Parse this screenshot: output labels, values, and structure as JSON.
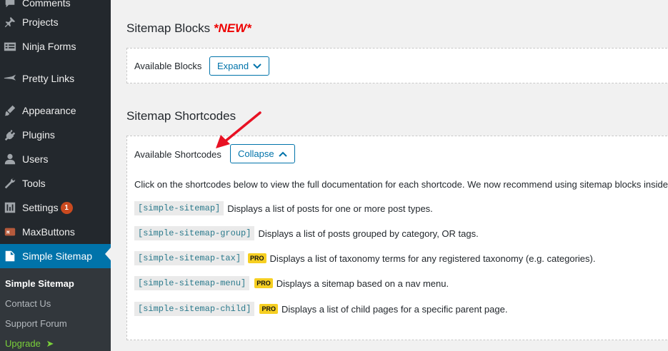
{
  "sidebar": {
    "items": [
      {
        "label": "Comments",
        "icon": "comments-icon"
      },
      {
        "label": "Projects",
        "icon": "pin-icon"
      },
      {
        "label": "Ninja Forms",
        "icon": "forms-icon"
      },
      {
        "label": "Pretty Links",
        "icon": "pretty-links-icon"
      },
      {
        "label": "Appearance",
        "icon": "brush-icon"
      },
      {
        "label": "Plugins",
        "icon": "plug-icon"
      },
      {
        "label": "Users",
        "icon": "user-icon"
      },
      {
        "label": "Tools",
        "icon": "wrench-icon"
      },
      {
        "label": "Settings",
        "icon": "settings-icon",
        "badge": "1"
      },
      {
        "label": "MaxButtons",
        "icon": "maxbuttons-icon"
      },
      {
        "label": "Simple Sitemap",
        "icon": "sitemap-icon"
      }
    ],
    "submenu": [
      "Simple Sitemap",
      "Contact Us",
      "Support Forum",
      "Upgrade"
    ],
    "upgrade_arrow": "➤"
  },
  "blocks": {
    "title": "Sitemap Blocks",
    "new_flag": "*NEW*",
    "label": "Available Blocks",
    "button": "Expand"
  },
  "shortcodes": {
    "title": "Sitemap Shortcodes",
    "label": "Available Shortcodes",
    "button": "Collapse",
    "intro": "Click on the shortcodes below to view the full documentation for each shortcode. We now recommend using sitemap blocks inside",
    "items": [
      {
        "code": "[simple-sitemap]",
        "pro": false,
        "text": "Displays a list of posts for one or more post types."
      },
      {
        "code": "[simple-sitemap-group]",
        "pro": false,
        "text": "Displays a list of posts grouped by category, OR tags."
      },
      {
        "code": "[simple-sitemap-tax]",
        "pro": true,
        "text": "Displays a list of taxonomy terms for any registered taxonomy (e.g. categories)."
      },
      {
        "code": "[simple-sitemap-menu]",
        "pro": true,
        "text": "Displays a sitemap based on a nav menu."
      },
      {
        "code": "[simple-sitemap-child]",
        "pro": true,
        "text": "Displays a list of child pages for a specific parent page."
      }
    ],
    "pro_label": "PRO"
  },
  "colors": {
    "sidebar_bg": "#23282d",
    "active": "#0073aa",
    "new_flag": "#ee0000",
    "pro": "#f6cf22",
    "arrow": "#e81123"
  }
}
